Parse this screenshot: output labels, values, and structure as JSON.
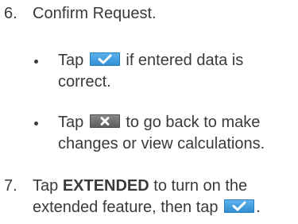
{
  "steps": [
    {
      "number": "6.",
      "text": "Confirm Request.",
      "bullets": [
        {
          "prefix": "Tap",
          "icon": "checkmark-icon",
          "line1_rest": "if entered data is",
          "line2": "correct."
        },
        {
          "prefix": "Tap",
          "icon": "close-icon",
          "line1_rest": "to go back to make",
          "line2": "changes or view calculations."
        }
      ]
    },
    {
      "number": "7.",
      "line1_prefix": "Tap",
      "line1_bold": "EXTENDED",
      "line1_rest": "to turn on the",
      "line2": "extended feature, then tap",
      "line2_end": ".",
      "icon": "checkmark-icon"
    }
  ],
  "colors": {
    "text": "#3a3a3a",
    "confirm_button": "#2f8dd3",
    "cancel_button": "#5a5a5a"
  }
}
